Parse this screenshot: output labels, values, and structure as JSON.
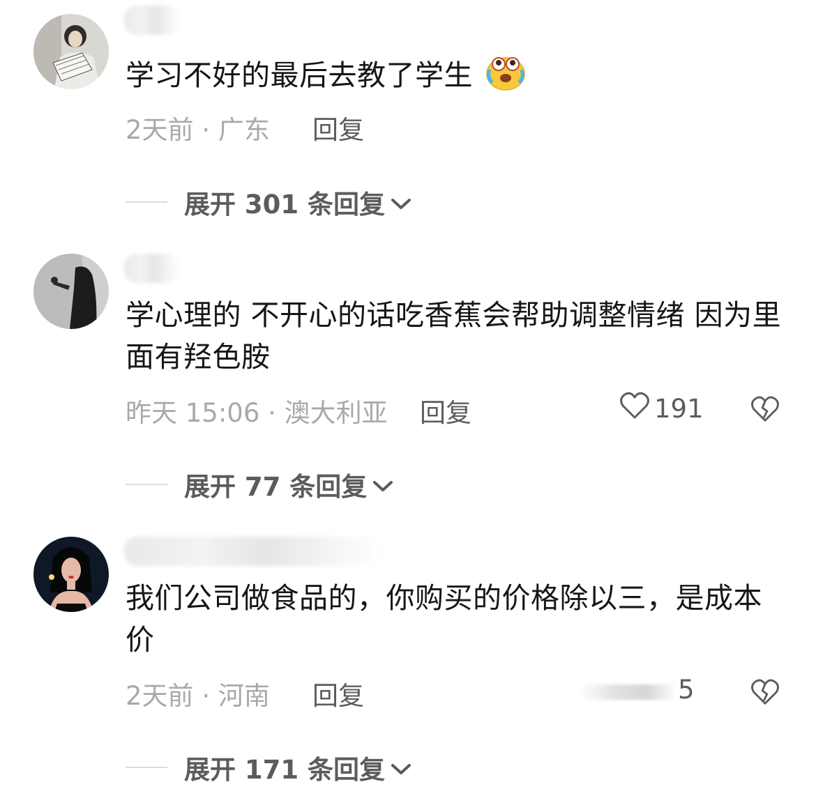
{
  "comments": [
    {
      "text": "学习不好的最后去教了学生",
      "emoji": "crying-laughing-face",
      "time": "2天前",
      "location": "广东",
      "reply_label": "回复",
      "expand_label": "展开 301 条回复"
    },
    {
      "text": "学心理的 不开心的话吃香蕉会帮助调整情绪 因为里面有羟色胺",
      "time": "昨天 15:06",
      "location": "澳大利亚",
      "reply_label": "回复",
      "likes": "191",
      "expand_label": "展开 77 条回复"
    },
    {
      "text": "我们公司做食品的，你购买的价格除以三，是成本价",
      "time": "2天前",
      "location": "河南",
      "reply_label": "回复",
      "likes": "5",
      "expand_label": "展开 171 条回复"
    }
  ],
  "separator": "·",
  "icons": {
    "like": "heart-outline-icon",
    "dislike": "broken-heart-icon",
    "expand": "chevron-down-icon"
  },
  "colors": {
    "text": "#161616",
    "meta": "#a9a9a9",
    "action": "#5c5c5c"
  }
}
